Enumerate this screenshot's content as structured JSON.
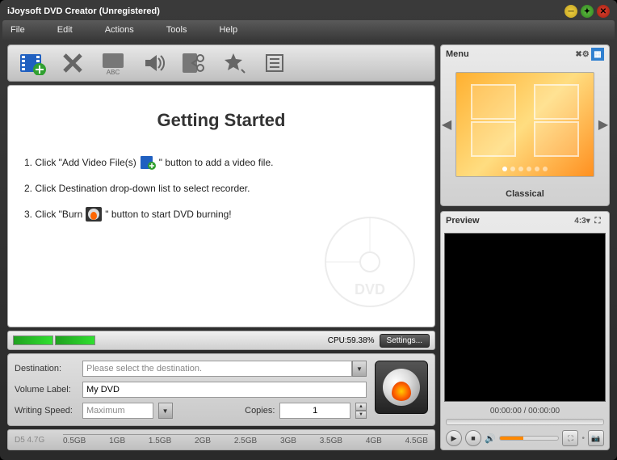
{
  "title": "iJoysoft DVD Creator (Unregistered)",
  "menubar": {
    "file": "File",
    "edit": "Edit",
    "actions": "Actions",
    "tools": "Tools",
    "help": "Help"
  },
  "content": {
    "heading": "Getting Started",
    "step1a": "1. Click \"Add Video File(s)",
    "step1b": "\" button to add a video file.",
    "step2": "2. Click Destination drop-down list to select recorder.",
    "step3a": "3. Click \"Burn",
    "step3b": "\" button to start DVD burning!"
  },
  "status": {
    "cpu": "CPU:59.38%",
    "settings": "Settings..."
  },
  "form": {
    "destination_label": "Destination:",
    "destination_placeholder": "Please select the destination.",
    "volume_label": "Volume Label:",
    "volume_value": "My DVD",
    "speed_label": "Writing Speed:",
    "speed_value": "Maximum",
    "copies_label": "Copies:",
    "copies_value": "1"
  },
  "ruler": {
    "label": "D5 4.7G",
    "ticks": [
      "0.5GB",
      "1GB",
      "1.5GB",
      "2GB",
      "2.5GB",
      "3GB",
      "3.5GB",
      "4GB",
      "4.5GB"
    ]
  },
  "menu_panel": {
    "title": "Menu",
    "caption": "Classical"
  },
  "preview_panel": {
    "title": "Preview",
    "aspect": "4:3▾",
    "time": "00:00:00 / 00:00:00"
  }
}
